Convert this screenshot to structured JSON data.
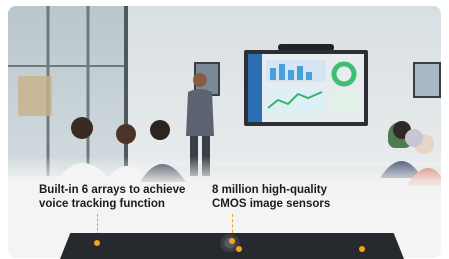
{
  "callouts": {
    "left": {
      "line1": "Built-in 6 arrays to achieve",
      "line2": "voice tracking function"
    },
    "right": {
      "line1": "8 million high-quality",
      "line2": "CMOS image sensors"
    }
  },
  "colors": {
    "accent": "#f6a31a",
    "device": "#26292d",
    "text": "#1c1c1c"
  },
  "icons": {
    "marker": "dot-marker-icon"
  }
}
